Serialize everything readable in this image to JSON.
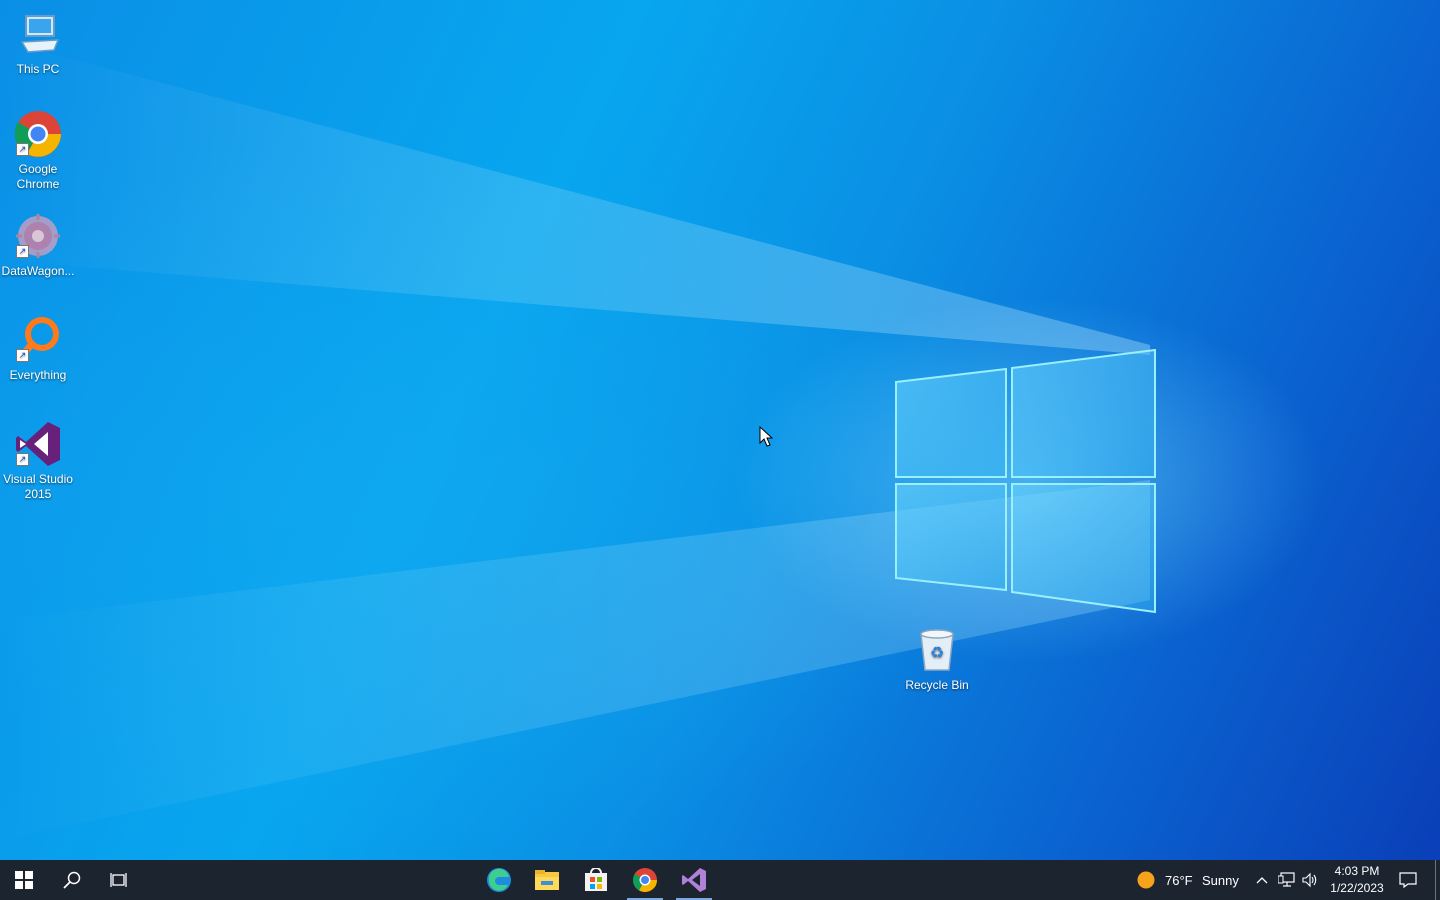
{
  "desktop": {
    "icons": [
      {
        "label": "This PC",
        "icon": "this-pc-icon"
      },
      {
        "label": "Google Chrome",
        "icon": "chrome-icon"
      },
      {
        "label": "DataWagon...",
        "icon": "datawagon-icon"
      },
      {
        "label": "Everything",
        "icon": "everything-icon"
      },
      {
        "label": "Visual Studio 2015",
        "icon": "visual-studio-icon"
      }
    ],
    "recycle_bin": {
      "label": "Recycle Bin",
      "icon": "recycle-bin-icon"
    }
  },
  "taskbar": {
    "start": {
      "icon": "windows-start-icon"
    },
    "search": {
      "icon": "search-icon"
    },
    "task_view": {
      "icon": "task-view-icon"
    },
    "pinned": [
      {
        "name": "Microsoft Edge",
        "icon": "edge-icon"
      },
      {
        "name": "File Explorer",
        "icon": "file-explorer-icon"
      },
      {
        "name": "Microsoft Store",
        "icon": "store-icon"
      },
      {
        "name": "Google Chrome",
        "icon": "chrome-icon"
      },
      {
        "name": "Visual Studio 2015",
        "icon": "visual-studio-icon"
      }
    ],
    "weather": {
      "temp": "76°F",
      "condition": "Sunny",
      "icon": "sun-icon"
    },
    "tray": {
      "chevron_icon": "chevron-up-icon",
      "network_icon": "network-icon",
      "volume_icon": "volume-icon"
    },
    "clock": {
      "time": "4:03 PM",
      "date": "1/22/2023"
    },
    "notifications_icon": "action-center-icon"
  },
  "colors": {
    "accent": "#0a78e0",
    "taskbar": "#1c2430"
  }
}
